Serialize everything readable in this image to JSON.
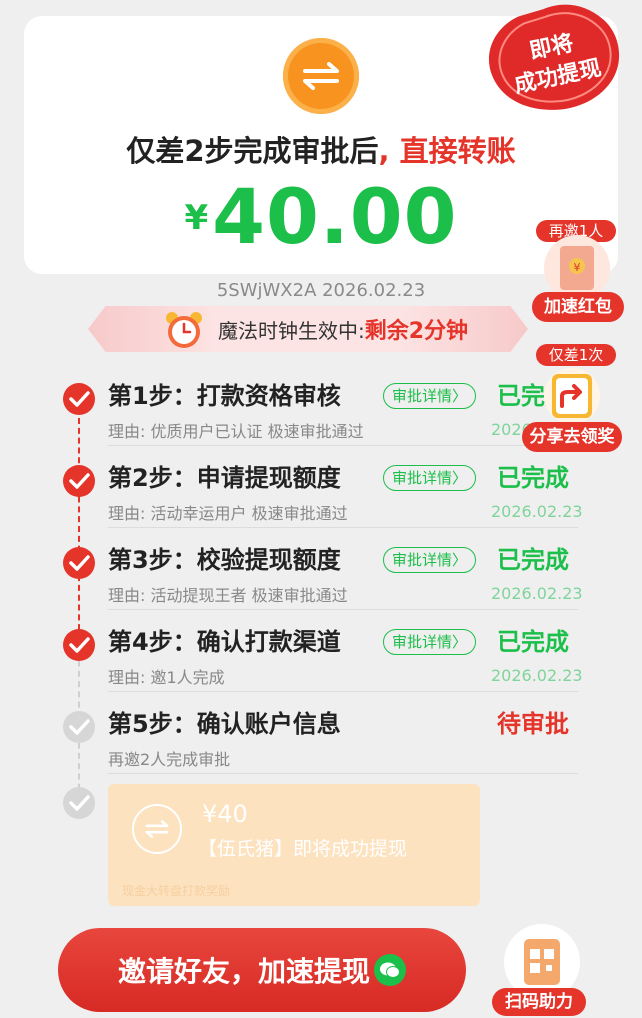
{
  "header": {
    "headline_main": "仅差2步完成审批后",
    "headline_sep": ",",
    "headline_highlight": " 直接转账",
    "currency": "¥",
    "amount": "40.00",
    "stamp_line1": "即将",
    "stamp_line2": "成功提现"
  },
  "meta": "5SWjWX2A 2026.02.23",
  "timer": {
    "label": "魔法时钟生效中: ",
    "remaining": "剩余2分钟"
  },
  "steps": [
    {
      "title": "第1步：打款资格审核",
      "pill": "审批详情〉",
      "state": "已完成",
      "reason": "理由: 优质用户已认证 极速审批通过",
      "date": "2026.02.23"
    },
    {
      "title": "第2步：申请提现额度",
      "pill": "审批详情〉",
      "state": "已完成",
      "reason": "理由: 活动幸运用户 极速审批通过",
      "date": "2026.02.23"
    },
    {
      "title": "第3步：校验提现额度",
      "pill": "审批详情〉",
      "state": "已完成",
      "reason": "理由: 活动提现王者 极速审批通过",
      "date": "2026.02.23"
    },
    {
      "title": "第4步：确认打款渠道",
      "pill": "审批详情〉",
      "state": "已完成",
      "reason": "理由: 邀1人完成",
      "date": "2026.02.23"
    },
    {
      "title": "第5步：确认账户信息",
      "state": "待审批",
      "reason": "再邀2人完成审批"
    }
  ],
  "reward": {
    "value": "¥40",
    "text": "【伍氏猪】即将成功提现",
    "footer": "现金大转盘打款奖励"
  },
  "side_widgets": {
    "red_packet_tag": "再邀1人",
    "red_packet_label": "加速红包",
    "share_tag": "仅差1次",
    "share_label": "分享去领奖"
  },
  "invite_button": "邀请好友，加速提现",
  "qr_label": "扫码助力",
  "colors": {
    "green": "#1cbf4a",
    "red": "#e5342a",
    "orange": "#f7931e",
    "reward_bg": "#fce2bf"
  },
  "icons": [
    "exchange-icon",
    "alarm-clock-icon",
    "check-circle-icon",
    "red-packet-icon",
    "share-icon",
    "wechat-icon",
    "qr-code-icon"
  ]
}
